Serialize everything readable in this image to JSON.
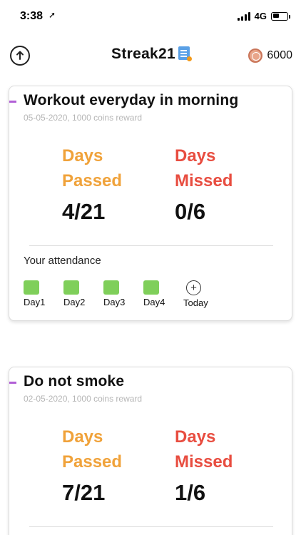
{
  "status_bar": {
    "time": "3:38",
    "network": "4G"
  },
  "header": {
    "title": "Streak21",
    "coins": "6000"
  },
  "cards": [
    {
      "title": "Workout everyday in morning",
      "subtitle": "05-05-2020, 1000 coins reward",
      "passed_label_line1": "Days",
      "passed_label_line2": "Passed",
      "passed_value": "4/21",
      "missed_label_line1": "Days",
      "missed_label_line2": "Missed",
      "missed_value": "0/6",
      "attendance_label": "Your attendance",
      "days": [
        "Day1",
        "Day2",
        "Day3",
        "Day4"
      ],
      "today_label": "Today"
    },
    {
      "title": "Do not smoke",
      "subtitle": "02-05-2020, 1000 coins reward",
      "passed_label_line1": "Days",
      "passed_label_line2": "Passed",
      "passed_value": "7/21",
      "missed_label_line1": "Days",
      "missed_label_line2": "Missed",
      "missed_value": "1/6"
    }
  ],
  "colors": {
    "passed": "#f0a23a",
    "missed": "#e84d40",
    "attended": "#7fcf5a",
    "accent": "#b15fd6"
  },
  "icons": {
    "power": "power-icon",
    "title_badge": "document-badge-icon",
    "coin": "coin-icon",
    "location": "location-arrow-icon",
    "add_today": "plus-circle-icon"
  }
}
